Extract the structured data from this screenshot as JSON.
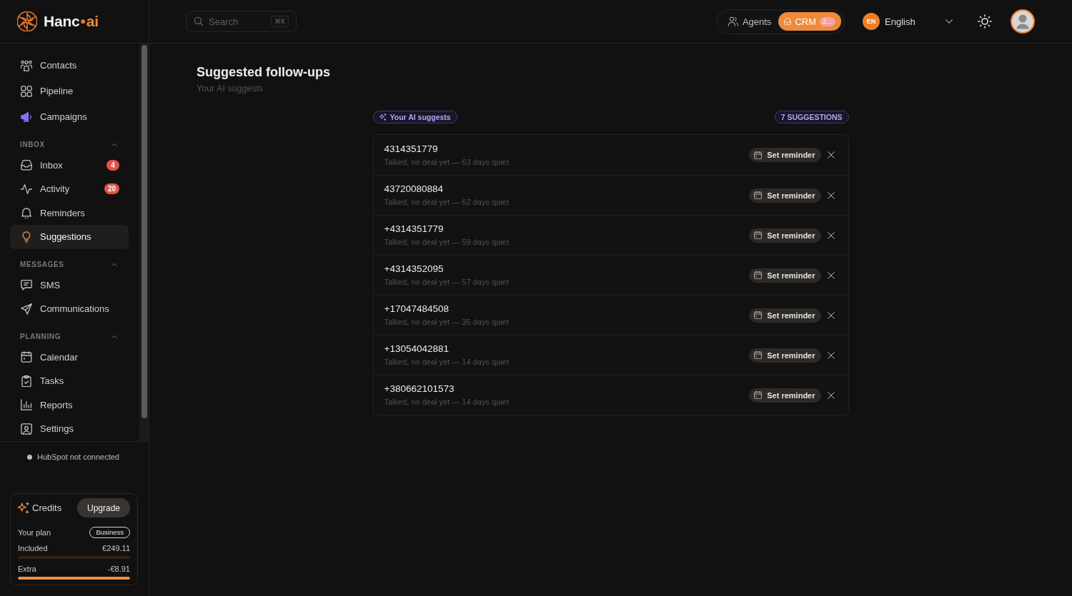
{
  "sidebar": {
    "logo": {
      "name": "Hanc",
      "separator": "•",
      "accent": "ai"
    },
    "nav": [
      {
        "label": "Contacts",
        "selected": false
      },
      {
        "label": "Pipeline",
        "selected": false
      },
      {
        "label": "Campaigns",
        "selected": false
      }
    ],
    "sections": [
      {
        "title": "INBOX",
        "expanded": true,
        "items": [
          {
            "label": "Inbox",
            "badge": "4",
            "selected": false
          },
          {
            "label": "Activity",
            "badge": "20",
            "selected": false
          },
          {
            "label": "Reminders",
            "selected": false
          },
          {
            "label": "Suggestions",
            "selected": true
          }
        ]
      },
      {
        "title": "MESSAGES",
        "expanded": true,
        "items": [
          {
            "label": "SMS",
            "selected": false
          },
          {
            "label": "Communications",
            "selected": false
          }
        ]
      },
      {
        "title": "PLANNING",
        "expanded": true,
        "items": [
          {
            "label": "Calendar",
            "selected": false
          },
          {
            "label": "Tasks",
            "selected": false
          },
          {
            "label": "Reports",
            "selected": false
          },
          {
            "label": "Settings",
            "selected": false
          }
        ]
      }
    ],
    "integration_status": {
      "text": "HubSpot not connected",
      "connected": false
    },
    "credits": {
      "title": "Credits",
      "action": "Upgrade",
      "plan_label": "Your plan",
      "plan": "Business",
      "usage": [
        {
          "label": "Included",
          "amount": "€249.11",
          "level": 0
        },
        {
          "label": "Extra",
          "amount": "-€8.91",
          "level": 1
        }
      ]
    }
  },
  "header": {
    "search": {
      "placeholder": "Search",
      "shortcut": "⌘K"
    },
    "mode_tabs": [
      {
        "label": "Agents",
        "selected": false
      },
      {
        "label": "CRM",
        "selected": true,
        "badge": "2…"
      }
    ],
    "language": {
      "code": "EN",
      "label": "English"
    }
  },
  "main": {
    "title": "Suggested follow-ups",
    "subtitle": "Your AI suggests",
    "tag": "Your AI suggests",
    "count": "7 SUGGESTIONS",
    "suggestions": [
      {
        "contact": "4314351779",
        "note": "Talked, no deal yet — 63 days quiet",
        "action": "Set reminder"
      },
      {
        "contact": "43720080884",
        "note": "Talked, no deal yet — 62 days quiet",
        "action": "Set reminder"
      },
      {
        "contact": "+4314351779",
        "note": "Talked, no deal yet — 59 days quiet",
        "action": "Set reminder"
      },
      {
        "contact": "+4314352095",
        "note": "Talked, no deal yet — 57 days quiet",
        "action": "Set reminder"
      },
      {
        "contact": "+17047484508",
        "note": "Talked, no deal yet — 35 days quiet",
        "action": "Set reminder"
      },
      {
        "contact": "+13054042881",
        "note": "Talked, no deal yet — 14 days quiet",
        "action": "Set reminder"
      },
      {
        "contact": "+380662101573",
        "note": "Talked, no deal yet — 14 days quiet",
        "action": "Set reminder"
      }
    ]
  }
}
